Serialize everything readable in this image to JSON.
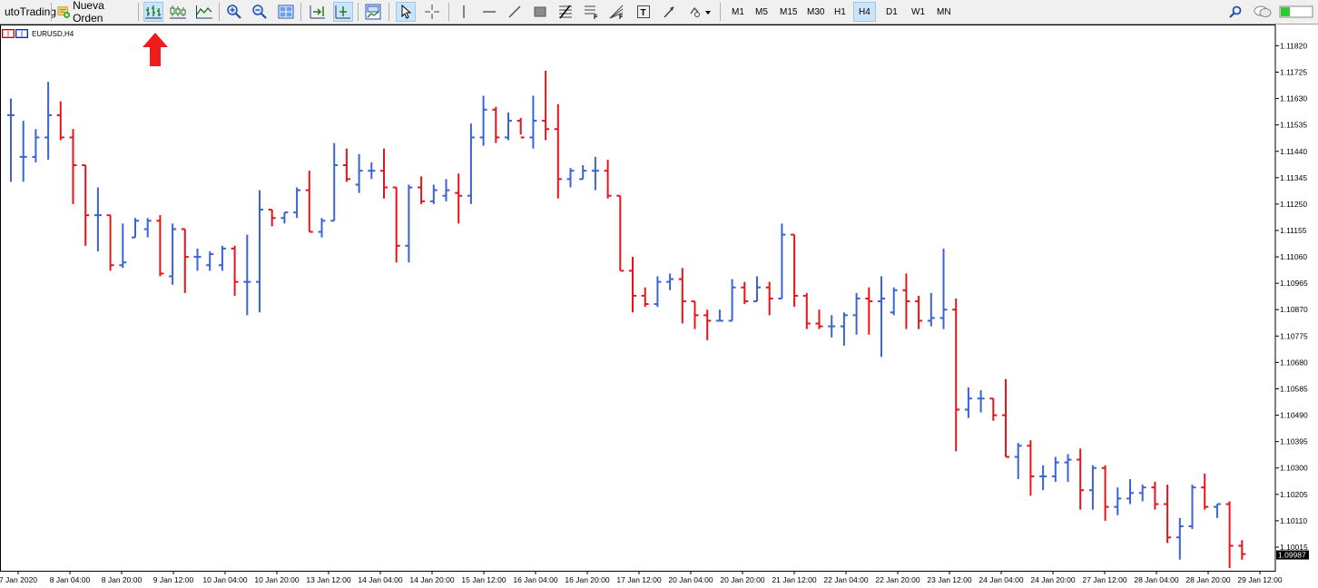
{
  "toolbar": {
    "autotrading_label": "utoTrading",
    "new_order_label": "Nueva Orden",
    "timeframes": [
      "M1",
      "M5",
      "M15",
      "M30",
      "H1",
      "H4",
      "D1",
      "W1",
      "MN"
    ],
    "active_timeframe": "H4",
    "icons": [
      "bar-chart-icon",
      "candlestick-icon",
      "line-chart-icon",
      "zoom-in-icon",
      "zoom-out-icon",
      "tile-windows-icon",
      "chart-shift-icon",
      "autoscroll-icon",
      "templates-icon",
      "cursor-icon",
      "crosshair-icon",
      "vertical-line-icon",
      "horizontal-line-icon",
      "trendline-icon",
      "rectangle-icon",
      "fibonacci-icon",
      "fibo-expansion-icon",
      "fibo-fan-icon",
      "text-icon",
      "arrow-icon",
      "shapes-icon",
      "search-icon",
      "chat-icon",
      "signal-icon"
    ]
  },
  "chart": {
    "symbol_label": "EURUSD,H4",
    "current_price": "1.09987",
    "annotation": "red-up-arrow-icon"
  },
  "chart_data": {
    "type": "ohlc-bar",
    "symbol": "EURUSD",
    "timeframe": "H4",
    "ylim": [
      1.0993,
      1.1189
    ],
    "y_ticks": [
      "1.11820",
      "1.11725",
      "1.11630",
      "1.11535",
      "1.11440",
      "1.11345",
      "1.11250",
      "1.11155",
      "1.11060",
      "1.10965",
      "1.10870",
      "1.10775",
      "1.10680",
      "1.10585",
      "1.10490",
      "1.10395",
      "1.10300",
      "1.10205",
      "1.10110",
      "1.10015"
    ],
    "x_ticks": [
      "7 Jan 2020",
      "8 Jan 04:00",
      "8 Jan 20:00",
      "9 Jan 12:00",
      "10 Jan 04:00",
      "10 Jan 20:00",
      "13 Jan 12:00",
      "14 Jan 04:00",
      "14 Jan 20:00",
      "15 Jan 12:00",
      "16 Jan 04:00",
      "16 Jan 20:00",
      "17 Jan 12:00",
      "20 Jan 04:00",
      "20 Jan 20:00",
      "21 Jan 12:00",
      "22 Jan 04:00",
      "22 Jan 20:00",
      "23 Jan 12:00",
      "24 Jan 04:00",
      "24 Jan 20:00",
      "27 Jan 12:00",
      "28 Jan 04:00",
      "28 Jan 20:00",
      "29 Jan 12:00"
    ],
    "colors": {
      "up": "#3b63d6",
      "down": "#e8141b",
      "grid_text": "#000000"
    },
    "bars": [
      {
        "o": 1.1157,
        "h": 1.1163,
        "l": 1.1133,
        "c": 1.1157
      },
      {
        "o": 1.1142,
        "h": 1.1155,
        "l": 1.1133,
        "c": 1.1142
      },
      {
        "o": 1.1142,
        "h": 1.1152,
        "l": 1.114,
        "c": 1.1149
      },
      {
        "o": 1.1149,
        "h": 1.1169,
        "l": 1.1141,
        "c": 1.1157
      },
      {
        "o": 1.1157,
        "h": 1.1162,
        "l": 1.1148,
        "c": 1.1149
      },
      {
        "o": 1.1149,
        "h": 1.1152,
        "l": 1.1125,
        "c": 1.1139
      },
      {
        "o": 1.1139,
        "h": 1.1139,
        "l": 1.111,
        "c": 1.1121
      },
      {
        "o": 1.1121,
        "h": 1.1131,
        "l": 1.1108,
        "c": 1.1121
      },
      {
        "o": 1.1121,
        "h": 1.1121,
        "l": 1.1101,
        "c": 1.1103
      },
      {
        "o": 1.1103,
        "h": 1.1118,
        "l": 1.1102,
        "c": 1.1104
      },
      {
        "o": 1.1113,
        "h": 1.112,
        "l": 1.1113,
        "c": 1.1119
      },
      {
        "o": 1.1116,
        "h": 1.112,
        "l": 1.1113,
        "c": 1.1119
      },
      {
        "o": 1.1119,
        "h": 1.1121,
        "l": 1.1099,
        "c": 1.11
      },
      {
        "o": 1.1099,
        "h": 1.1118,
        "l": 1.1096,
        "c": 1.1116
      },
      {
        "o": 1.1116,
        "h": 1.1116,
        "l": 1.1093,
        "c": 1.1106
      },
      {
        "o": 1.1106,
        "h": 1.1109,
        "l": 1.1101,
        "c": 1.1106
      },
      {
        "o": 1.1103,
        "h": 1.1108,
        "l": 1.1101,
        "c": 1.1107
      },
      {
        "o": 1.1103,
        "h": 1.111,
        "l": 1.1101,
        "c": 1.1109
      },
      {
        "o": 1.1109,
        "h": 1.111,
        "l": 1.1092,
        "c": 1.1097
      },
      {
        "o": 1.1097,
        "h": 1.1114,
        "l": 1.1085,
        "c": 1.1097
      },
      {
        "o": 1.1097,
        "h": 1.113,
        "l": 1.1086,
        "c": 1.1123
      },
      {
        "o": 1.1123,
        "h": 1.1123,
        "l": 1.1117,
        "c": 1.112
      },
      {
        "o": 1.112,
        "h": 1.1122,
        "l": 1.1118,
        "c": 1.1122
      },
      {
        "o": 1.1122,
        "h": 1.1131,
        "l": 1.112,
        "c": 1.113
      },
      {
        "o": 1.113,
        "h": 1.1137,
        "l": 1.1115,
        "c": 1.1115
      },
      {
        "o": 1.1115,
        "h": 1.112,
        "l": 1.1113,
        "c": 1.1119
      },
      {
        "o": 1.1119,
        "h": 1.1147,
        "l": 1.1119,
        "c": 1.1139
      },
      {
        "o": 1.1139,
        "h": 1.1145,
        "l": 1.1133,
        "c": 1.1134
      },
      {
        "o": 1.1132,
        "h": 1.1143,
        "l": 1.1129,
        "c": 1.1137
      },
      {
        "o": 1.1137,
        "h": 1.114,
        "l": 1.1134,
        "c": 1.1137
      },
      {
        "o": 1.1137,
        "h": 1.1145,
        "l": 1.1127,
        "c": 1.1131
      },
      {
        "o": 1.1131,
        "h": 1.1131,
        "l": 1.1104,
        "c": 1.111
      },
      {
        "o": 1.111,
        "h": 1.1132,
        "l": 1.1104,
        "c": 1.1131
      },
      {
        "o": 1.1131,
        "h": 1.1135,
        "l": 1.1125,
        "c": 1.1126
      },
      {
        "o": 1.1126,
        "h": 1.1132,
        "l": 1.1125,
        "c": 1.113
      },
      {
        "o": 1.1128,
        "h": 1.1134,
        "l": 1.1126,
        "c": 1.113
      },
      {
        "o": 1.1129,
        "h": 1.1136,
        "l": 1.1118,
        "c": 1.1128
      },
      {
        "o": 1.1128,
        "h": 1.1154,
        "l": 1.1125,
        "c": 1.1149
      },
      {
        "o": 1.1149,
        "h": 1.1164,
        "l": 1.1146,
        "c": 1.1159
      },
      {
        "o": 1.1159,
        "h": 1.116,
        "l": 1.1147,
        "c": 1.1149
      },
      {
        "o": 1.1149,
        "h": 1.1158,
        "l": 1.1148,
        "c": 1.1155
      },
      {
        "o": 1.1155,
        "h": 1.1156,
        "l": 1.115,
        "c": 1.1149
      },
      {
        "o": 1.1149,
        "h": 1.1164,
        "l": 1.1145,
        "c": 1.1155
      },
      {
        "o": 1.1155,
        "h": 1.1173,
        "l": 1.1148,
        "c": 1.1152
      },
      {
        "o": 1.1152,
        "h": 1.1161,
        "l": 1.1127,
        "c": 1.1134
      },
      {
        "o": 1.1134,
        "h": 1.1138,
        "l": 1.1131,
        "c": 1.1137
      },
      {
        "o": 1.1134,
        "h": 1.1139,
        "l": 1.1134,
        "c": 1.1137
      },
      {
        "o": 1.1137,
        "h": 1.1142,
        "l": 1.113,
        "c": 1.1137
      },
      {
        "o": 1.1137,
        "h": 1.1141,
        "l": 1.1127,
        "c": 1.1128
      },
      {
        "o": 1.1128,
        "h": 1.1128,
        "l": 1.1101,
        "c": 1.1101
      },
      {
        "o": 1.1101,
        "h": 1.1106,
        "l": 1.1086,
        "c": 1.1092
      },
      {
        "o": 1.1092,
        "h": 1.1095,
        "l": 1.1088,
        "c": 1.1089
      },
      {
        "o": 1.1089,
        "h": 1.1099,
        "l": 1.1088,
        "c": 1.1097
      },
      {
        "o": 1.1097,
        "h": 1.11,
        "l": 1.1094,
        "c": 1.1098
      },
      {
        "o": 1.1098,
        "h": 1.1102,
        "l": 1.1082,
        "c": 1.109
      },
      {
        "o": 1.109,
        "h": 1.109,
        "l": 1.108,
        "c": 1.1085
      },
      {
        "o": 1.1085,
        "h": 1.1087,
        "l": 1.1076,
        "c": 1.1083
      },
      {
        "o": 1.1083,
        "h": 1.1087,
        "l": 1.1083,
        "c": 1.1083
      },
      {
        "o": 1.1083,
        "h": 1.1098,
        "l": 1.1083,
        "c": 1.1095
      },
      {
        "o": 1.1095,
        "h": 1.1097,
        "l": 1.1089,
        "c": 1.109
      },
      {
        "o": 1.109,
        "h": 1.1099,
        "l": 1.109,
        "c": 1.1095
      },
      {
        "o": 1.1095,
        "h": 1.1097,
        "l": 1.1085,
        "c": 1.1091
      },
      {
        "o": 1.1091,
        "h": 1.1118,
        "l": 1.1091,
        "c": 1.1114
      },
      {
        "o": 1.1114,
        "h": 1.1114,
        "l": 1.1088,
        "c": 1.1092
      },
      {
        "o": 1.1092,
        "h": 1.1093,
        "l": 1.108,
        "c": 1.1082
      },
      {
        "o": 1.1082,
        "h": 1.1087,
        "l": 1.108,
        "c": 1.1081
      },
      {
        "o": 1.1081,
        "h": 1.1085,
        "l": 1.1077,
        "c": 1.1081
      },
      {
        "o": 1.1081,
        "h": 1.1086,
        "l": 1.1074,
        "c": 1.1085
      },
      {
        "o": 1.1085,
        "h": 1.1093,
        "l": 1.1078,
        "c": 1.1091
      },
      {
        "o": 1.1091,
        "h": 1.1095,
        "l": 1.1078,
        "c": 1.109
      },
      {
        "o": 1.109,
        "h": 1.1099,
        "l": 1.107,
        "c": 1.1091
      },
      {
        "o": 1.1086,
        "h": 1.1095,
        "l": 1.1085,
        "c": 1.1094
      },
      {
        "o": 1.1094,
        "h": 1.11,
        "l": 1.108,
        "c": 1.109
      },
      {
        "o": 1.109,
        "h": 1.1092,
        "l": 1.108,
        "c": 1.1083
      },
      {
        "o": 1.1083,
        "h": 1.1093,
        "l": 1.1081,
        "c": 1.1084
      },
      {
        "o": 1.1084,
        "h": 1.1109,
        "l": 1.108,
        "c": 1.1087
      },
      {
        "o": 1.1087,
        "h": 1.1091,
        "l": 1.1036,
        "c": 1.1051
      },
      {
        "o": 1.1051,
        "h": 1.1059,
        "l": 1.1048,
        "c": 1.1055
      },
      {
        "o": 1.1055,
        "h": 1.1058,
        "l": 1.105,
        "c": 1.1055
      },
      {
        "o": 1.1055,
        "h": 1.1055,
        "l": 1.1047,
        "c": 1.1049
      },
      {
        "o": 1.1049,
        "h": 1.1062,
        "l": 1.1034,
        "c": 1.1034
      },
      {
        "o": 1.1034,
        "h": 1.1039,
        "l": 1.1026,
        "c": 1.1038
      },
      {
        "o": 1.1038,
        "h": 1.104,
        "l": 1.102,
        "c": 1.1027
      },
      {
        "o": 1.1027,
        "h": 1.1031,
        "l": 1.1022,
        "c": 1.1027
      },
      {
        "o": 1.1027,
        "h": 1.1034,
        "l": 1.1025,
        "c": 1.1032
      },
      {
        "o": 1.1032,
        "h": 1.1035,
        "l": 1.1025,
        "c": 1.1033
      },
      {
        "o": 1.1033,
        "h": 1.1037,
        "l": 1.1015,
        "c": 1.1022
      },
      {
        "o": 1.1022,
        "h": 1.1031,
        "l": 1.1015,
        "c": 1.103
      },
      {
        "o": 1.103,
        "h": 1.1031,
        "l": 1.1011,
        "c": 1.1016
      },
      {
        "o": 1.1016,
        "h": 1.1023,
        "l": 1.1013,
        "c": 1.1019
      },
      {
        "o": 1.1019,
        "h": 1.1026,
        "l": 1.1017,
        "c": 1.1021
      },
      {
        "o": 1.1021,
        "h": 1.1024,
        "l": 1.1018,
        "c": 1.1023
      },
      {
        "o": 1.1023,
        "h": 1.1025,
        "l": 1.1015,
        "c": 1.1017
      },
      {
        "o": 1.1017,
        "h": 1.1024,
        "l": 1.1003,
        "c": 1.1005
      },
      {
        "o": 1.1005,
        "h": 1.1012,
        "l": 1.0997,
        "c": 1.1009
      },
      {
        "o": 1.1009,
        "h": 1.1024,
        "l": 1.1008,
        "c": 1.1023
      },
      {
        "o": 1.1023,
        "h": 1.1028,
        "l": 1.1015,
        "c": 1.1016
      },
      {
        "o": 1.1016,
        "h": 1.1017,
        "l": 1.1012,
        "c": 1.1017
      },
      {
        "o": 1.1017,
        "h": 1.1018,
        "l": 1.0994,
        "c": 1.1002
      },
      {
        "o": 1.1002,
        "h": 1.1004,
        "l": 1.0997,
        "c": 1.0999
      }
    ]
  }
}
